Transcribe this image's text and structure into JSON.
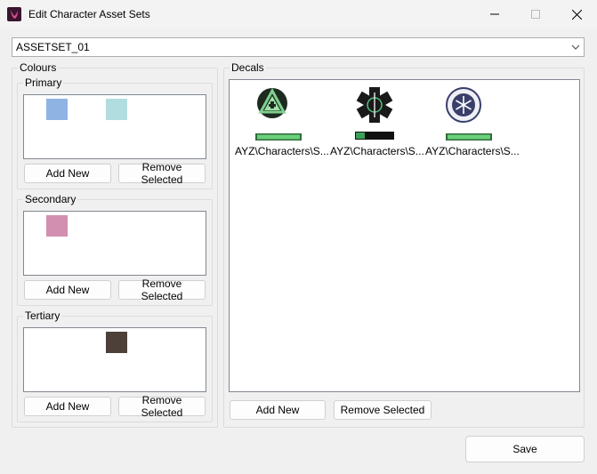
{
  "window": {
    "title": "Edit Character Asset Sets",
    "icon": "app-logo-icon"
  },
  "asset_set_select": {
    "value": "ASSETSET_01"
  },
  "colours": {
    "label": "Colours",
    "primary": {
      "label": "Primary",
      "swatches": [
        "#8fb4e3",
        "#b2dde0"
      ],
      "add_label": "Add New",
      "remove_label": "Remove Selected"
    },
    "secondary": {
      "label": "Secondary",
      "swatches": [
        "#d28fb0"
      ],
      "add_label": "Add New",
      "remove_label": "Remove Selected"
    },
    "tertiary": {
      "label": "Tertiary",
      "swatches": [
        "#4d4038"
      ],
      "add_label": "Add New",
      "remove_label": "Remove Selected"
    }
  },
  "decals": {
    "label": "Decals",
    "items": [
      {
        "caption": "AYZ\\Characters\\S...",
        "icon": "hazard-triangle-decal-icon"
      },
      {
        "caption": "AYZ\\Characters\\S...",
        "icon": "medic-star-decal-icon"
      },
      {
        "caption": "AYZ\\Characters\\S...",
        "icon": "snowflake-seal-decal-icon"
      }
    ],
    "add_label": "Add New",
    "remove_label": "Remove Selected"
  },
  "save_label": "Save"
}
